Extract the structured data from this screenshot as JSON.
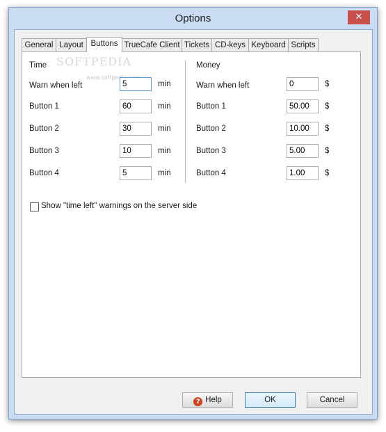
{
  "window": {
    "title": "Options",
    "close_glyph": "✕"
  },
  "tabs": [
    {
      "label": "General"
    },
    {
      "label": "Layout"
    },
    {
      "label": "Buttons"
    },
    {
      "label": "TrueCafe Client"
    },
    {
      "label": "Tickets"
    },
    {
      "label": "CD-keys"
    },
    {
      "label": "Keyboard"
    },
    {
      "label": "Scripts"
    }
  ],
  "active_tab": "Buttons",
  "time": {
    "heading": "Time",
    "unit": "min",
    "rows": [
      {
        "label": "Warn when left",
        "value": "5"
      },
      {
        "label": "Button 1",
        "value": "60"
      },
      {
        "label": "Button 2",
        "value": "30"
      },
      {
        "label": "Button 3",
        "value": "10"
      },
      {
        "label": "Button 4",
        "value": "5"
      }
    ]
  },
  "money": {
    "heading": "Money",
    "unit": "$",
    "rows": [
      {
        "label": "Warn when left",
        "value": "0"
      },
      {
        "label": "Button 1",
        "value": "50.00"
      },
      {
        "label": "Button 2",
        "value": "10.00"
      },
      {
        "label": "Button 3",
        "value": "5.00"
      },
      {
        "label": "Button 4",
        "value": "1.00"
      }
    ]
  },
  "server_warnings": {
    "label": "Show \"time left\" warnings on the server side",
    "checked": false
  },
  "watermark": {
    "text": "SOFTPEDIA",
    "url": "www.softpedia.com"
  },
  "buttons": {
    "help": "Help",
    "ok": "OK",
    "cancel": "Cancel",
    "help_icon_glyph": "?"
  },
  "colors": {
    "title_bar": "#c9dcf3",
    "close_button": "#c7504d",
    "focus_border": "#5b9bd5",
    "help_icon": "#d1421e"
  }
}
